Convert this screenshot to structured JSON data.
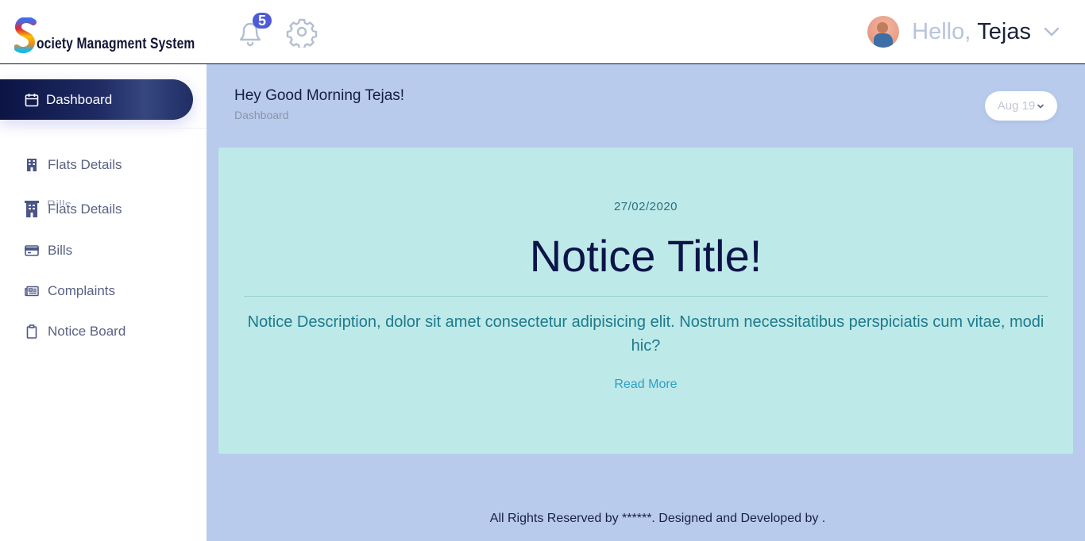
{
  "header": {
    "logo_text": "ociety Managment System",
    "logo_letter": "S",
    "notification_count": "5",
    "greeting_prefix": "Hello,",
    "user_name": "Tejas"
  },
  "sidebar": {
    "active_item": {
      "label": "Dashboard",
      "icon": "calendar-icon"
    },
    "items": [
      {
        "label": "Flats Details",
        "icon": "building-icon"
      },
      {
        "label": "Flats Details",
        "icon": "building-icon"
      },
      {
        "label": "Bills",
        "icon": "credit-card-icon"
      },
      {
        "label": "Complaints",
        "icon": "newspaper-icon"
      },
      {
        "label": "Notice Board",
        "icon": "clipboard-icon"
      }
    ],
    "overlapped_text": "Bills"
  },
  "page": {
    "greeting": "Hey Good Morning Tejas!",
    "breadcrumb": "Dashboard",
    "date_filter": "Aug 19"
  },
  "notice": {
    "date": "27/02/2020",
    "title": "Notice Title!",
    "description": "Notice Description, dolor sit amet consectetur adipisicing elit. Nostrum necessitatibus perspiciatis cum vitae, modi hic?",
    "read_more": "Read More"
  },
  "footer": {
    "text": "All Rights Reserved by ******. Designed and Developed by ."
  },
  "colors": {
    "accent": "#0b1444",
    "main_bg": "#b8cbec",
    "card_bg": "#bde9e8",
    "badge": "#4e5bd6"
  }
}
